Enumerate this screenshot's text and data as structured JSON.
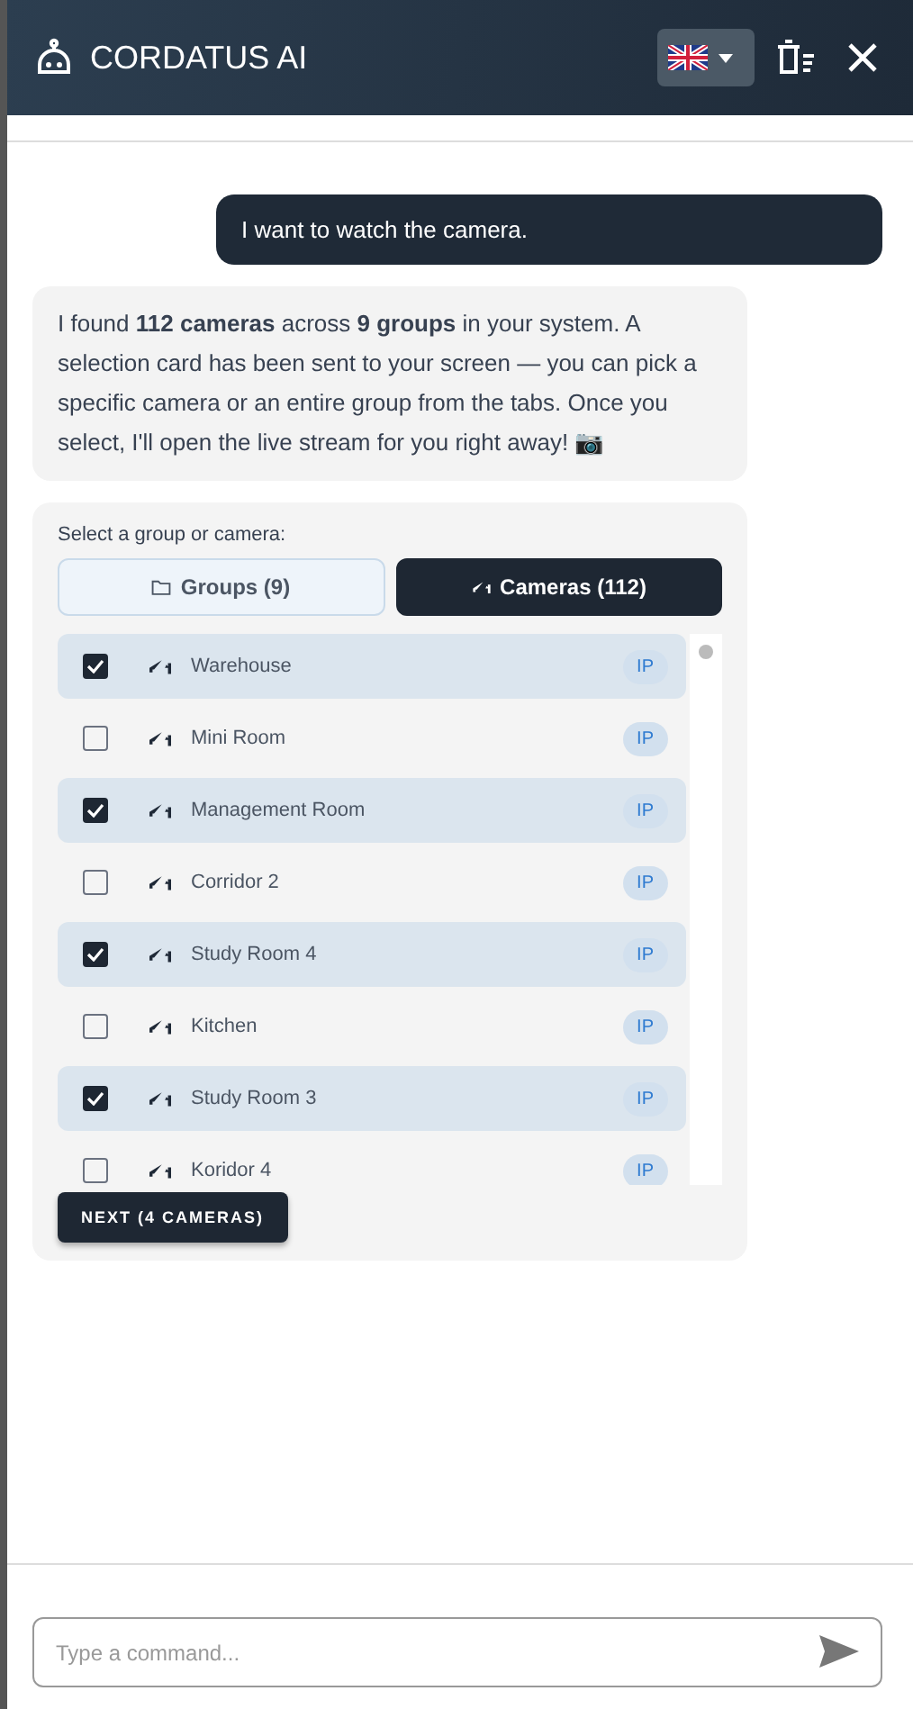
{
  "header": {
    "title": "CORDATUS AI"
  },
  "messages": [
    {
      "kind": "user",
      "text": "I want to watch the camera."
    },
    {
      "kind": "bot",
      "text": "I found **112 cameras** across **9 groups** in your system. A selection card has been sent to your screen — you can pick a specific camera or an entire group from the tabs. Once you select, I'll open the live stream for you right away! 📷"
    }
  ],
  "selection_card": {
    "prompt": "Select a group or camera:",
    "tabs": [
      {
        "kind": "groups",
        "label": "Groups (9)",
        "selected": false
      },
      {
        "kind": "cameras",
        "label": "Cameras (112)",
        "selected": true
      }
    ],
    "cameras": [
      {
        "name": "Warehouse",
        "badge": "IP",
        "checked": true
      },
      {
        "name": "Mini Room",
        "badge": "IP",
        "checked": false
      },
      {
        "name": "Management Room",
        "badge": "IP",
        "checked": true
      },
      {
        "name": "Corridor 2",
        "badge": "IP",
        "checked": false
      },
      {
        "name": "Study Room 4",
        "badge": "IP",
        "checked": true
      },
      {
        "name": "Kitchen",
        "badge": "IP",
        "checked": false
      },
      {
        "name": "Study Room 3",
        "badge": "IP",
        "checked": true
      },
      {
        "name": "Koridor 4",
        "badge": "IP",
        "checked": false
      }
    ],
    "next_button": "NEXT (4 CAMERAS)"
  },
  "input": {
    "placeholder": "Type a command..."
  }
}
